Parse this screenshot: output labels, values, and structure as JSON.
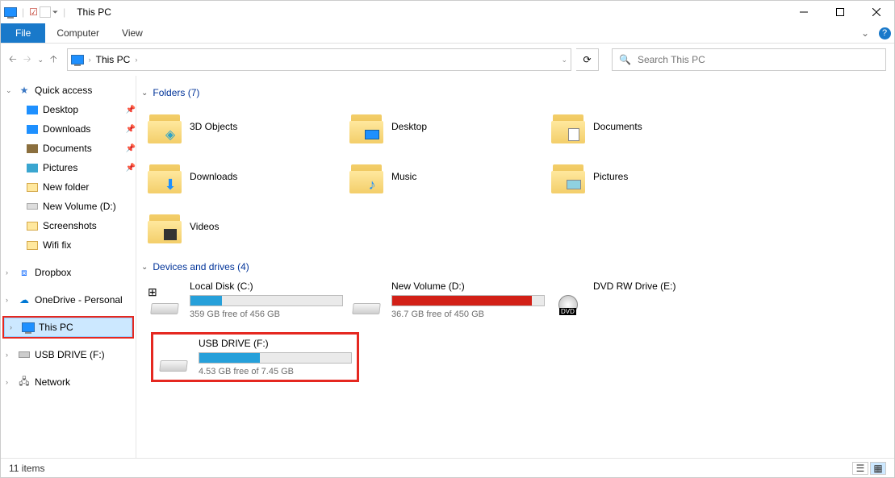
{
  "window": {
    "title": "This PC"
  },
  "ribbon": {
    "file": "File",
    "tabs": [
      "Computer",
      "View"
    ]
  },
  "nav": {
    "path": [
      "This PC"
    ],
    "search_placeholder": "Search This PC"
  },
  "sidebar": {
    "quick_access": {
      "label": "Quick access",
      "items": [
        {
          "label": "Desktop",
          "pinned": true,
          "icon": "desktop"
        },
        {
          "label": "Downloads",
          "pinned": true,
          "icon": "downloads"
        },
        {
          "label": "Documents",
          "pinned": true,
          "icon": "documents"
        },
        {
          "label": "Pictures",
          "pinned": true,
          "icon": "pictures"
        },
        {
          "label": "New folder",
          "pinned": false,
          "icon": "folder"
        },
        {
          "label": "New Volume (D:)",
          "pinned": false,
          "icon": "drive"
        },
        {
          "label": "Screenshots",
          "pinned": false,
          "icon": "folder"
        },
        {
          "label": "Wifi fix",
          "pinned": false,
          "icon": "folder"
        }
      ]
    },
    "dropbox": {
      "label": "Dropbox"
    },
    "onedrive": {
      "label": "OneDrive - Personal"
    },
    "this_pc": {
      "label": "This PC"
    },
    "usb": {
      "label": "USB DRIVE (F:)"
    },
    "network": {
      "label": "Network"
    }
  },
  "sections": {
    "folders": {
      "title": "Folders (7)",
      "items": [
        {
          "label": "3D Objects",
          "sub": "3d"
        },
        {
          "label": "Desktop",
          "sub": "desktop"
        },
        {
          "label": "Documents",
          "sub": "documents"
        },
        {
          "label": "Downloads",
          "sub": "downloads"
        },
        {
          "label": "Music",
          "sub": "music"
        },
        {
          "label": "Pictures",
          "sub": "pictures"
        },
        {
          "label": "Videos",
          "sub": "videos"
        }
      ]
    },
    "drives": {
      "title": "Devices and drives (4)",
      "items": [
        {
          "label": "Local Disk (C:)",
          "free_text": "359 GB free of 456 GB",
          "fill_pct": 21,
          "bar_color": "#26a0da",
          "icon": "os"
        },
        {
          "label": "New Volume (D:)",
          "free_text": "36.7 GB free of 450 GB",
          "fill_pct": 92,
          "bar_color": "#d22017",
          "icon": "hdd"
        },
        {
          "label": "DVD RW Drive (E:)",
          "free_text": "",
          "fill_pct": 0,
          "bar_color": "",
          "icon": "dvd",
          "no_bar": true
        },
        {
          "label": "USB DRIVE (F:)",
          "free_text": "4.53 GB free of 7.45 GB",
          "fill_pct": 40,
          "bar_color": "#26a0da",
          "icon": "usb",
          "highlight": true
        }
      ]
    }
  },
  "status": {
    "text": "11 items"
  }
}
